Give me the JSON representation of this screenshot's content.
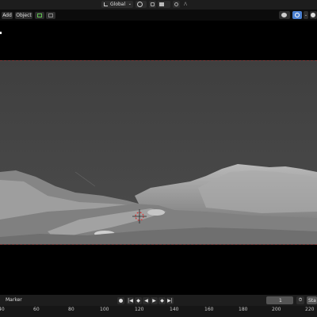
{
  "header": {
    "transform_orientation": "Global",
    "add_menu": "Add",
    "object_menu": "Object"
  },
  "timeline": {
    "marker_menu": "Marker",
    "current_frame": "1",
    "start_label": "Sta",
    "ruler_ticks": [
      "40",
      "60",
      "80",
      "100",
      "120",
      "140",
      "160",
      "180",
      "200",
      "220"
    ]
  },
  "colors": {
    "accent": "#4a7fcf",
    "frame_border": "#7a3a3a",
    "terrain": "#9a9a9a",
    "sky": "#434343"
  },
  "icons": [
    "transform-orientation-icon",
    "pivot-icon",
    "snap-icon",
    "snap-target-icon",
    "proportional-edit-icon",
    "object-mode-icon",
    "viewport-gizmo-icon",
    "overlay-icon",
    "xray-icon",
    "shading-solid-icon",
    "play-icon",
    "keyframe-icon",
    "stopwatch-icon"
  ]
}
